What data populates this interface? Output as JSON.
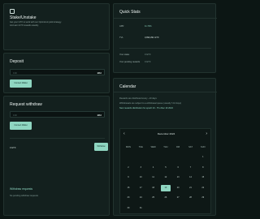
{
  "accent": "#8fd6c1",
  "stake": {
    "icon": "square-icon",
    "title": "Stake/Unstake",
    "desc_line1": "Get your GTX to work with our Optimized yield strategy.",
    "desc_line2": "And earn GTX rewards weekly."
  },
  "quick_stats": {
    "title": "Quick Stats",
    "apr_label": "APR",
    "apr_value": "11.74%",
    "tvl_label": "TVL",
    "tvl_value": "3,993,291 GTX",
    "your_stake_label": "Your stake",
    "your_stake_value": "0 GTX",
    "pending_label": "Your pending rewards",
    "pending_value": "0 GTX"
  },
  "deposit": {
    "title": "Deposit",
    "placeholder": "0.00",
    "max_label": "MAX",
    "button": "Connect Wallet"
  },
  "withdraw": {
    "title": "Request withdraw",
    "placeholder": "0.00",
    "max_label": "MAX",
    "button": "Connect Wallet",
    "withdrawable_value": "0 GTX",
    "withdraw_button": "Withdraw",
    "requests_title": "Withdraw requests",
    "requests_empty": "No pending withdraw requests"
  },
  "calendar": {
    "title": "Calendar",
    "note1": "Rewards are distributed every ~10 days",
    "note2": "Withdrawals are subject to a withdrawal queue (usually 7-10 days)",
    "note3": "Next rewards distribution for epoch 23 - Thu Dec 19 2024",
    "month": "December 2024",
    "prev_icon": "chevron-left-icon",
    "next_icon": "chevron-right-icon",
    "weekdays": [
      "MON",
      "TUE",
      "WED",
      "THU",
      "FRI",
      "SAT",
      "SUN"
    ],
    "weeks": [
      [
        "",
        "",
        "",
        "",
        "",
        "",
        "1"
      ],
      [
        "2",
        "3",
        "4",
        "5",
        "6",
        "7",
        "8"
      ],
      [
        "9",
        "10",
        "11",
        "12",
        "13",
        "14",
        "15"
      ],
      [
        "16",
        "17",
        "18",
        "19",
        "20",
        "21",
        "22"
      ],
      [
        "23",
        "24",
        "25",
        "26",
        "27",
        "28",
        "29"
      ],
      [
        "30",
        "31",
        "",
        "",
        "",
        "",
        ""
      ]
    ],
    "selected_day": "19"
  }
}
